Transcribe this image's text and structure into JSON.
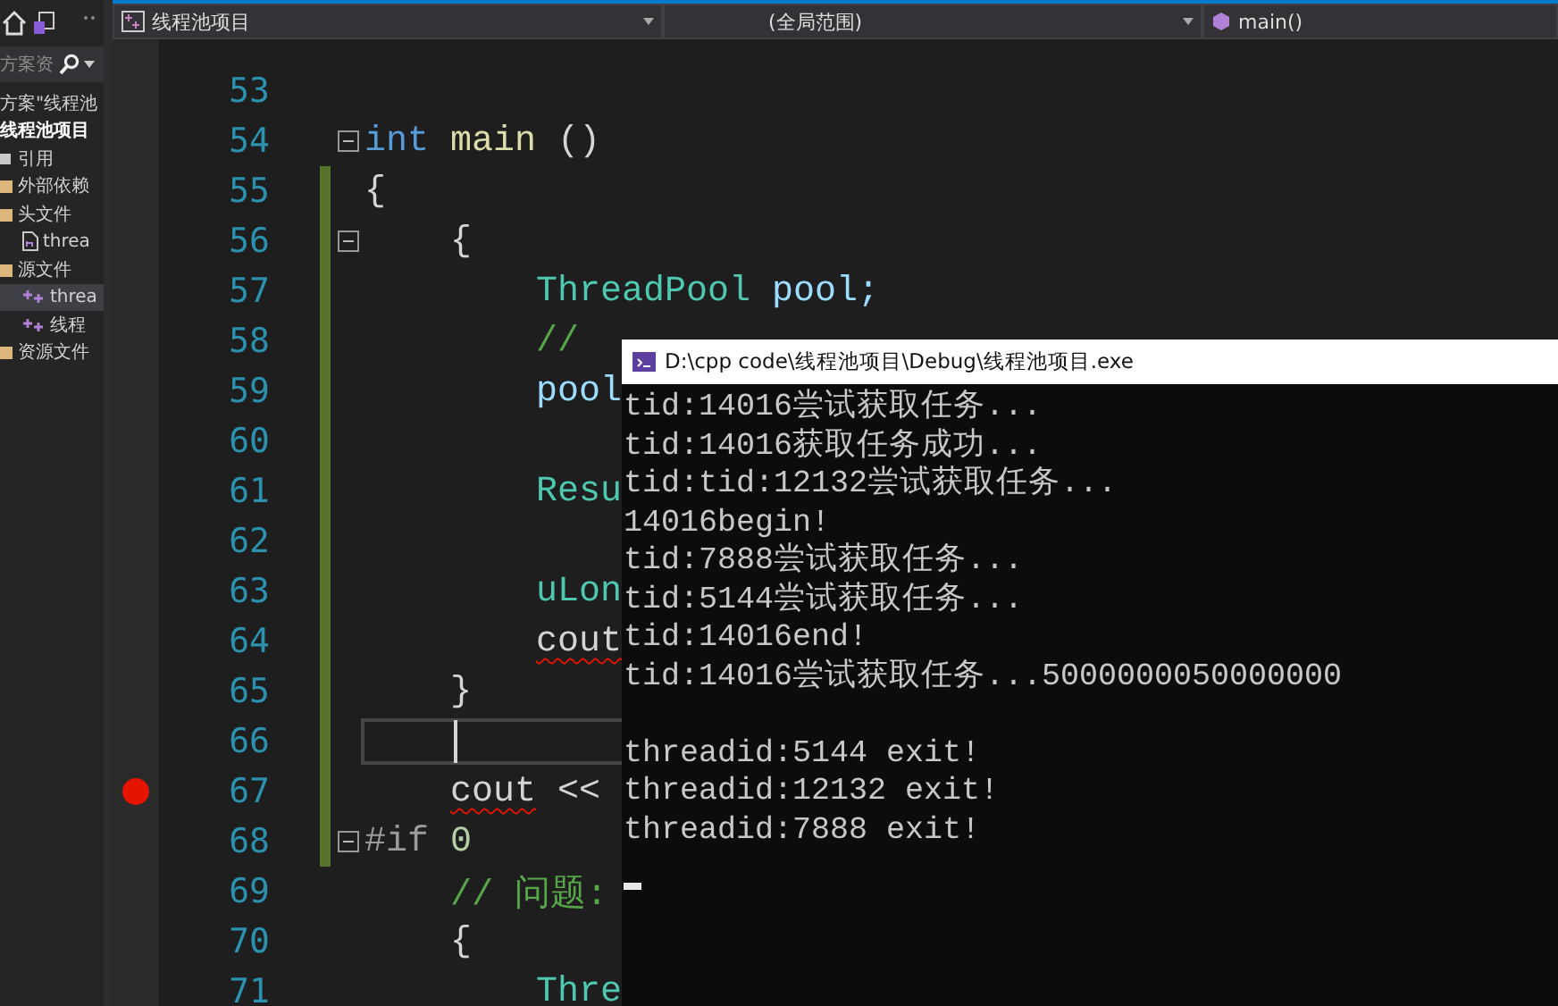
{
  "solution_explorer": {
    "search": {
      "placeholder": "方案资"
    },
    "tree": [
      {
        "label": "方案\"线程池",
        "kind": "solution",
        "selected": false,
        "children": [
          {
            "label": "线程池项目",
            "kind": "project",
            "selected": false,
            "children": [
              {
                "label": "引用",
                "kind": "references",
                "selected": false
              },
              {
                "label": "外部依赖",
                "kind": "folder",
                "selected": false
              },
              {
                "label": "头文件",
                "kind": "folder",
                "selected": false,
                "children": [
                  {
                    "label": "threa",
                    "kind": "header-file",
                    "selected": false
                  }
                ]
              },
              {
                "label": "源文件",
                "kind": "folder",
                "selected": false,
                "children": [
                  {
                    "label": "threa",
                    "kind": "source-file",
                    "selected": true
                  },
                  {
                    "label": "线程",
                    "kind": "source-file",
                    "selected": false
                  }
                ]
              },
              {
                "label": "资源文件",
                "kind": "folder",
                "selected": false
              }
            ]
          }
        ]
      }
    ]
  },
  "navigation_bar": {
    "project": "线程池项目",
    "scope": "(全局范围)",
    "member": "main()"
  },
  "editor": {
    "lines": [
      {
        "number": "53",
        "changed": false,
        "fold": false,
        "breakpoint": false,
        "current": false
      },
      {
        "number": "54",
        "changed": false,
        "fold": true,
        "breakpoint": false,
        "current": false,
        "tokens": [
          {
            "text": "int",
            "kind": "keyword"
          },
          {
            "text": "main",
            "kind": "function"
          },
          {
            "text": "()",
            "kind": "punct"
          }
        ]
      },
      {
        "number": "55",
        "changed": true,
        "fold": false,
        "breakpoint": false,
        "current": false,
        "tokens": [
          {
            "text": "{",
            "kind": "punct"
          }
        ]
      },
      {
        "number": "56",
        "changed": true,
        "fold": true,
        "breakpoint": false,
        "current": false,
        "tokens": [
          {
            "text": "    {",
            "kind": "punct"
          }
        ]
      },
      {
        "number": "57",
        "changed": true,
        "fold": false,
        "breakpoint": false,
        "current": false,
        "tokens": [
          {
            "text": "        ThreadPool",
            "kind": "type"
          },
          {
            "text": "pool;",
            "kind": "variable"
          }
        ]
      },
      {
        "number": "58",
        "changed": true,
        "fold": false,
        "breakpoint": false,
        "current": false,
        "tokens": [
          {
            "text": "        //",
            "kind": "comment"
          }
        ]
      },
      {
        "number": "59",
        "changed": true,
        "fold": false,
        "breakpoint": false,
        "current": false,
        "tokens": [
          {
            "text": "        pool",
            "kind": "variable"
          }
        ]
      },
      {
        "number": "60",
        "changed": true,
        "fold": false,
        "breakpoint": false,
        "current": false
      },
      {
        "number": "61",
        "changed": true,
        "fold": false,
        "breakpoint": false,
        "current": false,
        "tokens": [
          {
            "text": "        Resu",
            "kind": "type"
          }
        ]
      },
      {
        "number": "62",
        "changed": true,
        "fold": false,
        "breakpoint": false,
        "current": false
      },
      {
        "number": "63",
        "changed": true,
        "fold": false,
        "breakpoint": false,
        "current": false,
        "tokens": [
          {
            "text": "        uLon",
            "kind": "type"
          }
        ]
      },
      {
        "number": "64",
        "changed": true,
        "fold": false,
        "breakpoint": false,
        "current": false,
        "tokens": [
          {
            "text": "        cout",
            "kind": "error"
          }
        ]
      },
      {
        "number": "65",
        "changed": true,
        "fold": false,
        "breakpoint": false,
        "current": false,
        "tokens": [
          {
            "text": "    }",
            "kind": "punct"
          }
        ]
      },
      {
        "number": "66",
        "changed": true,
        "fold": false,
        "breakpoint": false,
        "current": true
      },
      {
        "number": "67",
        "changed": true,
        "fold": false,
        "breakpoint": true,
        "current": false,
        "tokens": [
          {
            "text": "    cout",
            "kind": "error"
          },
          {
            "text": "<<",
            "kind": "punct"
          }
        ]
      },
      {
        "number": "68",
        "changed": true,
        "fold": true,
        "breakpoint": false,
        "current": false,
        "tokens": [
          {
            "text": "#if",
            "kind": "preproc"
          },
          {
            "text": "0",
            "kind": "number"
          }
        ]
      },
      {
        "number": "69",
        "changed": false,
        "fold": false,
        "breakpoint": false,
        "current": false,
        "tokens": [
          {
            "text": "    // 问题:",
            "kind": "comment"
          }
        ]
      },
      {
        "number": "70",
        "changed": false,
        "fold": false,
        "breakpoint": false,
        "current": false,
        "tokens": [
          {
            "text": "    {",
            "kind": "punct"
          }
        ]
      },
      {
        "number": "71",
        "changed": false,
        "fold": false,
        "breakpoint": false,
        "current": false,
        "tokens": [
          {
            "text": "        Thre",
            "kind": "type"
          }
        ]
      }
    ]
  },
  "console": {
    "title": "D:\\cpp code\\线程池项目\\Debug\\线程池项目.exe",
    "blocks": [
      [
        "tid:14016尝试获取任务...",
        "tid:14016获取任务成功...",
        "tid:tid:12132尝试获取任务...",
        "14016begin!",
        "tid:7888尝试获取任务...",
        "tid:5144尝试获取任务...",
        "tid:14016end!",
        "tid:14016尝试获取任务...5000000050000000"
      ],
      [
        "threadid:5144 exit!",
        "threadid:12132 exit!",
        "threadid:7888 exit!"
      ]
    ]
  }
}
